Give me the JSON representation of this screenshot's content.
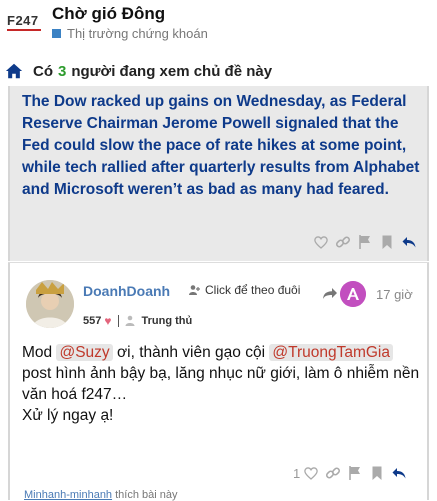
{
  "header": {
    "logo_text": "F247",
    "title": "Chờ gió Đông",
    "category": "Thị trường chứng khoán",
    "category_color": "#3b82c4"
  },
  "viewers": {
    "prefix": "Có",
    "count": "3",
    "suffix": "người đang xem chủ đề này"
  },
  "post1": {
    "body": "The Dow racked up gains on Wednesday, as Federal Reserve Chairman Jerome Powell signaled that the Fed could slow the pace of rate hikes at some point, while tech rallied after quarterly results from Alphabet and Microsoft weren’t as bad as many had feared.",
    "icons": [
      "heart-icon",
      "link-icon",
      "flag-icon",
      "bookmark-icon",
      "reply-icon"
    ]
  },
  "post2": {
    "username": "DoanhDoanh",
    "follow_label": "Click để theo đuôi",
    "likes_received": "557",
    "rank": "Trung thủ",
    "time": "17 giờ",
    "body_parts": {
      "p1": "Mod ",
      "mention1": "@Suzy",
      "p2": " ơi, thành viên gạo cội ",
      "mention2": "@TruongTamGia",
      "p3": " post hình ảnh bậy bạ, lăng nhục nữ giới, làm ô nhiễm nền văn hoá f247…",
      "line2": "Xử lý ngay ạ!"
    },
    "like_count": "1",
    "liked_by_user": "Minhanh-minhanh",
    "liked_by_suffix": "thích bài này"
  }
}
